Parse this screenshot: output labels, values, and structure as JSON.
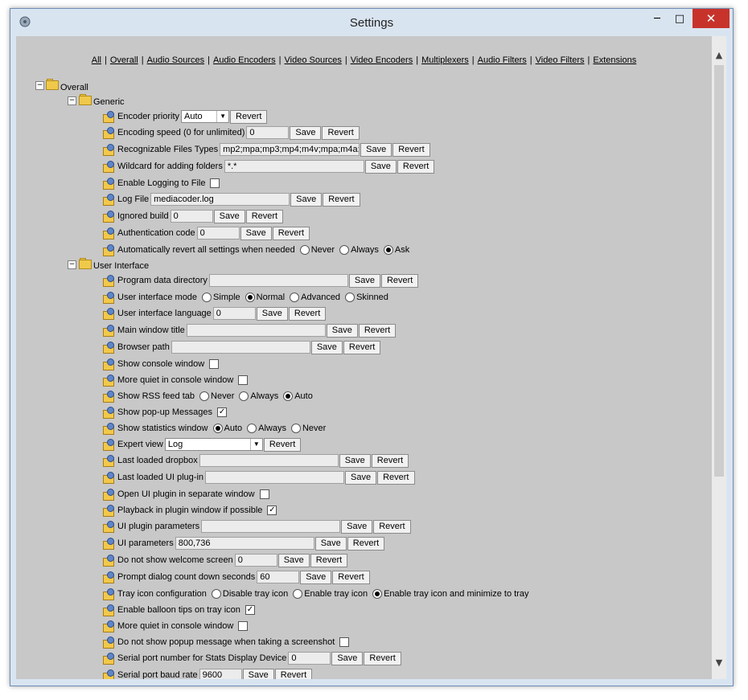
{
  "window": {
    "title": "Settings",
    "minimize": "─",
    "maximize": "□",
    "close": "✕"
  },
  "nav": [
    "All",
    "Overall",
    "Audio Sources",
    "Audio Encoders",
    "Video Sources",
    "Video Encoders",
    "Multiplexers",
    "Audio Filters",
    "Video Filters",
    "Extensions"
  ],
  "tree": {
    "root": "Overall",
    "generic": "Generic",
    "ui": "User Interface",
    "expand_icon": "−"
  },
  "buttons": {
    "save": "Save",
    "revert": "Revert"
  },
  "settings": {
    "encoder_priority": {
      "label": "Encoder priority",
      "value": "Auto"
    },
    "encoding_speed": {
      "label": "Encoding speed (0 for unlimited)",
      "value": "0"
    },
    "recognizable": {
      "label": "Recognizable Files Types",
      "value": "mp2;mpa;mp3;mp4;m4v;mpa;m4a;"
    },
    "wildcard": {
      "label": "Wildcard for adding folders",
      "value": "*.*"
    },
    "enable_logging": {
      "label": "Enable Logging to File",
      "checked": false
    },
    "log_file": {
      "label": "Log File",
      "value": "mediacoder.log"
    },
    "ignored_build": {
      "label": "Ignored build",
      "value": "0"
    },
    "auth_code": {
      "label": "Authentication code",
      "value": "0"
    },
    "auto_revert": {
      "label": "Automatically revert all settings when needed",
      "options": [
        "Never",
        "Always",
        "Ask"
      ],
      "selected": 2
    },
    "program_data_dir": {
      "label": "Program data directory",
      "value": ""
    },
    "ui_mode": {
      "label": "User interface mode",
      "options": [
        "Simple",
        "Normal",
        "Advanced",
        "Skinned"
      ],
      "selected": 1
    },
    "ui_language": {
      "label": "User interface language",
      "value": "0"
    },
    "main_window_title": {
      "label": "Main window title",
      "value": ""
    },
    "browser_path": {
      "label": "Browser path",
      "value": ""
    },
    "show_console": {
      "label": "Show console window",
      "checked": false
    },
    "more_quiet_1": {
      "label": "More quiet in console window",
      "checked": false
    },
    "show_rss": {
      "label": "Show RSS feed tab",
      "options": [
        "Never",
        "Always",
        "Auto"
      ],
      "selected": 2
    },
    "show_popup": {
      "label": "Show pop-up Messages",
      "checked": true
    },
    "show_stats": {
      "label": "Show statistics window",
      "options": [
        "Auto",
        "Always",
        "Never"
      ],
      "selected": 0
    },
    "expert_view": {
      "label": "Expert view",
      "value": "Log"
    },
    "last_dropbox": {
      "label": "Last loaded dropbox",
      "value": ""
    },
    "last_ui_plugin": {
      "label": "Last loaded UI plug-in",
      "value": ""
    },
    "open_ui_plugin": {
      "label": "Open UI plugin in separate window",
      "checked": false
    },
    "playback_plugin": {
      "label": "Playback in plugin window if possible",
      "checked": true
    },
    "ui_plugin_params": {
      "label": "UI plugin parameters",
      "value": ""
    },
    "ui_params": {
      "label": "UI parameters",
      "value": "800,736"
    },
    "no_welcome": {
      "label": "Do not show welcome screen",
      "value": "0"
    },
    "prompt_countdown": {
      "label": "Prompt dialog count down seconds",
      "value": "60"
    },
    "tray_icon": {
      "label": "Tray icon configuration",
      "options": [
        "Disable tray icon",
        "Enable tray icon",
        "Enable tray icon and minimize to tray"
      ],
      "selected": 2
    },
    "balloon_tips": {
      "label": "Enable balloon tips on tray icon",
      "checked": true
    },
    "more_quiet_2": {
      "label": "More quiet in console window",
      "checked": false
    },
    "no_popup_screenshot": {
      "label": "Do not show popup message when taking a screenshot",
      "checked": false
    },
    "serial_port": {
      "label": "Serial port number for Stats Display Device",
      "value": "0"
    },
    "baud_rate": {
      "label": "Serial port baud rate",
      "value": "9600"
    }
  },
  "scrollbar": {
    "up": "▲",
    "down": "▼"
  }
}
